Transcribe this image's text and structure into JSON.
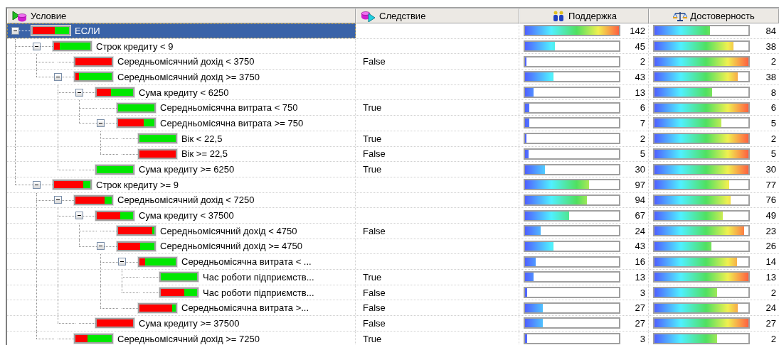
{
  "columns": [
    {
      "label": "Условие",
      "kind": "condition"
    },
    {
      "label": "Следствие",
      "kind": "consequence"
    },
    {
      "label": "Поддержка",
      "kind": "support"
    },
    {
      "label": "Достоверность",
      "kind": "confidence"
    }
  ],
  "tree": {
    "condition": "ЕСЛИ",
    "selected": true,
    "expanded": true,
    "level": 0.6,
    "support": {
      "value": "142",
      "level": 1
    },
    "confidence": {
      "value": "84",
      "level": 0.592
    },
    "children": [
      {
        "condition": "Строк кредиту < 9",
        "selected": false,
        "expanded": true,
        "level": 0.15,
        "support": {
          "value": "45",
          "level": 0.317
        },
        "confidence": {
          "value": "38",
          "level": 0.844
        },
        "children": [
          {
            "condition": "Середньомісячний дохід < 3750",
            "result": "False",
            "selected": false,
            "level": 1,
            "support": {
              "value": "2",
              "level": 0.014
            },
            "confidence": {
              "value": "2",
              "level": 1
            }
          },
          {
            "condition": "Середньомісячний дохід >= 3750",
            "selected": false,
            "expanded": true,
            "level": 0.1,
            "support": {
              "value": "43",
              "level": 0.303
            },
            "confidence": {
              "value": "38",
              "level": 0.884
            },
            "children": [
              {
                "condition": "Сума кредиту < 6250",
                "selected": false,
                "expanded": true,
                "level": 0.4,
                "support": {
                  "value": "13",
                  "level": 0.092
                },
                "confidence": {
                  "value": "8",
                  "level": 0.615
                },
                "children": [
                  {
                    "condition": "Середньомісячна витрата < 750",
                    "result": "True",
                    "selected": false,
                    "support": {
                      "value": "6",
                      "level": 0.042
                    },
                    "confidence": {
                      "value": "6",
                      "level": 1
                    }
                  },
                  {
                    "condition": "Середньомісячна витрата >= 750",
                    "selected": false,
                    "expanded": true,
                    "level": 0.7,
                    "support": {
                      "value": "7",
                      "level": 0.049
                    },
                    "confidence": {
                      "value": "5",
                      "level": 0.714
                    },
                    "children": [
                      {
                        "condition": "Вік < 22,5",
                        "result": "True",
                        "selected": false,
                        "support": {
                          "value": "2",
                          "level": 0.014
                        },
                        "confidence": {
                          "value": "2",
                          "level": 1
                        }
                      },
                      {
                        "condition": "Вік >= 22,5",
                        "result": "False",
                        "selected": false,
                        "level": 1,
                        "support": {
                          "value": "5",
                          "level": 0.035
                        },
                        "confidence": {
                          "value": "5",
                          "level": 1
                        }
                      }
                    ]
                  }
                ]
              },
              {
                "condition": "Сума кредиту >= 6250",
                "result": "True",
                "selected": false,
                "support": {
                  "value": "30",
                  "level": 0.211
                },
                "confidence": {
                  "value": "30",
                  "level": 1
                }
              }
            ]
          }
        ]
      },
      {
        "condition": "Строк кредиту >= 9",
        "selected": false,
        "expanded": true,
        "level": 0.8,
        "support": {
          "value": "97",
          "level": 0.683
        },
        "confidence": {
          "value": "77",
          "level": 0.794
        },
        "children": [
          {
            "condition": "Середньомісячний дохід < 7250",
            "selected": false,
            "expanded": true,
            "level": 0.8,
            "support": {
              "value": "94",
              "level": 0.662
            },
            "confidence": {
              "value": "76",
              "level": 0.809
            },
            "children": [
              {
                "condition": "Сума кредиту < 37500",
                "selected": false,
                "expanded": true,
                "level": 0.65,
                "support": {
                  "value": "67",
                  "level": 0.472
                },
                "confidence": {
                  "value": "49",
                  "level": 0.731
                },
                "children": [
                  {
                    "condition": "Середньомісячний дохід < 4750",
                    "result": "False",
                    "selected": false,
                    "level": 0.95,
                    "support": {
                      "value": "24",
                      "level": 0.169
                    },
                    "confidence": {
                      "value": "23",
                      "level": 0.958
                    }
                  },
                  {
                    "condition": "Середньомісячний дохід >= 4750",
                    "selected": false,
                    "expanded": true,
                    "level": 0.6,
                    "support": {
                      "value": "43",
                      "level": 0.303
                    },
                    "confidence": {
                      "value": "26",
                      "level": 0.605
                    },
                    "children": [
                      {
                        "condition": "Середньомісячна витрата < ...",
                        "selected": false,
                        "expanded": true,
                        "level": 0.15,
                        "support": {
                          "value": "16",
                          "level": 0.113
                        },
                        "confidence": {
                          "value": "14",
                          "level": 0.875
                        },
                        "children": [
                          {
                            "condition": "Час роботи підприємств...",
                            "result": "True",
                            "selected": false,
                            "support": {
                              "value": "13",
                              "level": 0.092
                            },
                            "confidence": {
                              "value": "13",
                              "level": 1
                            }
                          },
                          {
                            "condition": "Час роботи підприємств...",
                            "result": "False",
                            "selected": false,
                            "level": 0.65,
                            "support": {
                              "value": "3",
                              "level": 0.021
                            },
                            "confidence": {
                              "value": "2",
                              "level": 0.667
                            }
                          }
                        ]
                      },
                      {
                        "condition": "Середньомісячна витрата >...",
                        "result": "False",
                        "selected": false,
                        "level": 0.9,
                        "support": {
                          "value": "27",
                          "level": 0.19
                        },
                        "confidence": {
                          "value": "24",
                          "level": 0.889
                        }
                      }
                    ]
                  }
                ]
              },
              {
                "condition": "Сума кредиту >= 37500",
                "result": "False",
                "selected": false,
                "level": 1,
                "support": {
                  "value": "27",
                  "level": 0.19
                },
                "confidence": {
                  "value": "27",
                  "level": 1
                }
              }
            ]
          },
          {
            "condition": "Середньомісячний дохід >= 7250",
            "result": "True",
            "selected": false,
            "level": 0.33,
            "support": {
              "value": "3",
              "level": 0.021
            },
            "confidence": {
              "value": "2",
              "level": 0.667
            }
          }
        ]
      }
    ]
  }
}
